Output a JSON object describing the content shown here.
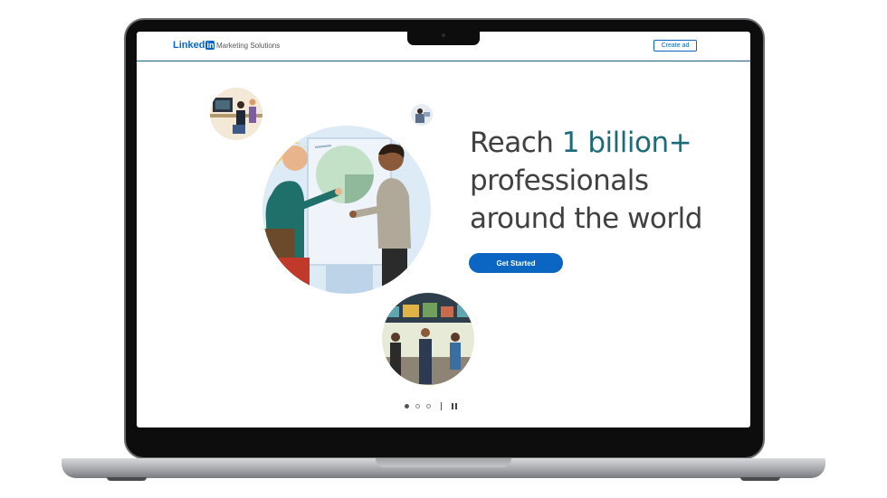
{
  "header": {
    "logo_text": "Linked",
    "logo_in": "in",
    "product_name": "Marketing Solutions",
    "create_ad_label": "Create ad"
  },
  "hero": {
    "headline_prefix": "Reach ",
    "headline_accent": "1 billion+",
    "headline_line2": "professionals",
    "headline_line3": "around the world",
    "cta_label": "Get Started"
  },
  "carousel": {
    "slide_count": 3,
    "active_slide": 1
  },
  "colors": {
    "brand_blue": "#0a66c2",
    "accent_teal": "#1d6b79",
    "text_dark": "#404040"
  },
  "icons": [
    "camera-icon",
    "pause-icon"
  ]
}
